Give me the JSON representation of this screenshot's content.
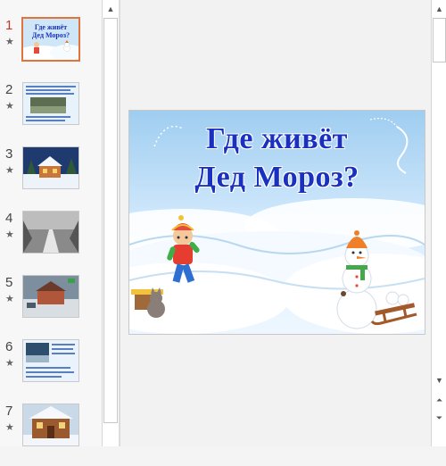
{
  "thumbnails": [
    {
      "number": "1",
      "star": "★",
      "selected": true
    },
    {
      "number": "2",
      "star": "★"
    },
    {
      "number": "3",
      "star": "★"
    },
    {
      "number": "4",
      "star": "★"
    },
    {
      "number": "5",
      "star": "★"
    },
    {
      "number": "6",
      "star": "★"
    },
    {
      "number": "7",
      "star": "★"
    }
  ],
  "slide": {
    "title_line1": "Где живёт",
    "title_line2": "Дед Мороз?"
  },
  "thumb1": {
    "line1": "Где живёт",
    "line2": "Дед Мороз?"
  },
  "scroll": {
    "up": "▲",
    "down": "▼",
    "prev_slide": "⏶",
    "next_slide": "⏷"
  },
  "colors": {
    "selected_border": "#e0743c",
    "title_blue": "#1930c0",
    "sky": "#cfe6f6"
  }
}
